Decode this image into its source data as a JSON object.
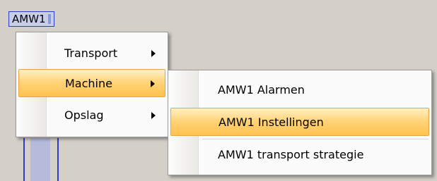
{
  "machine": {
    "tag_label": "AMW1"
  },
  "context_menu": {
    "items": [
      {
        "label": "Transport",
        "has_submenu": true
      },
      {
        "label": "Machine",
        "has_submenu": true
      },
      {
        "label": "Opslag",
        "has_submenu": true
      }
    ]
  },
  "submenu": {
    "items": [
      {
        "label": "AMW1 Alarmen"
      },
      {
        "label": "AMW1 Instellingen"
      },
      {
        "label": "AMW1 transport strategie"
      }
    ]
  },
  "colors": {
    "highlight": "#ffd47a",
    "highlight_border": "#e8a548",
    "tag_border": "#2a3fd0"
  }
}
